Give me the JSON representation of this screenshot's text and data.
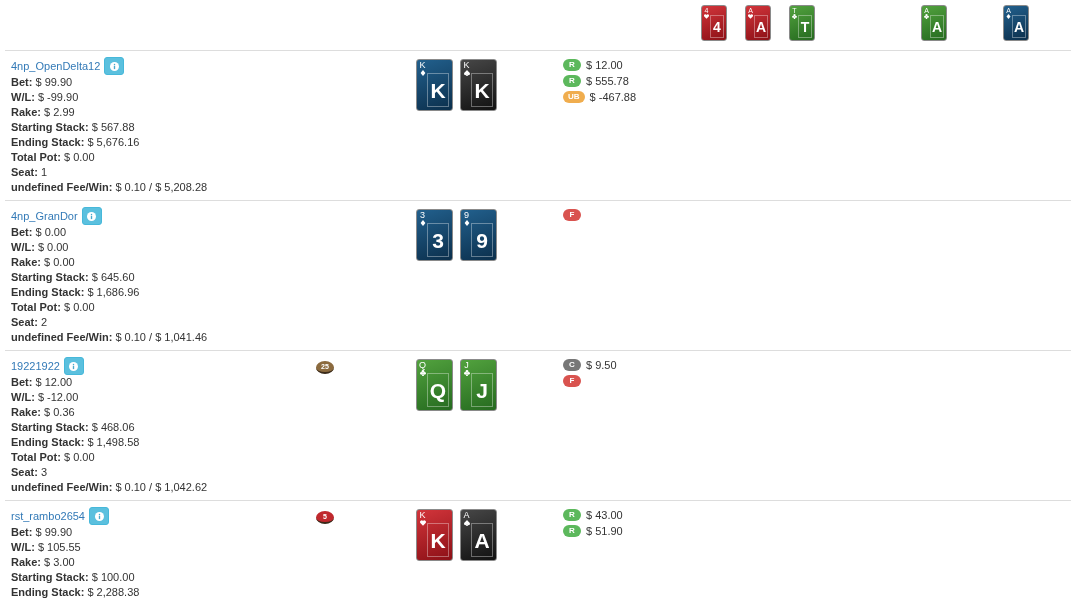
{
  "board": {
    "flop": [
      {
        "corner": "4",
        "rank": "4",
        "kind": "hearts"
      },
      {
        "corner": "A",
        "rank": "A",
        "kind": "hearts"
      },
      {
        "corner": "T",
        "rank": "T",
        "kind": "clubs"
      }
    ],
    "turn": [
      {
        "corner": "A",
        "rank": "A",
        "kind": "clubs"
      }
    ],
    "river": [
      {
        "corner": "A",
        "rank": "A",
        "kind": "diamonds"
      }
    ]
  },
  "players": [
    {
      "name": "4np_OpenDelta12",
      "stats": [
        {
          "label": "Bet:",
          "value": "$ 99.90"
        },
        {
          "label": "W/L:",
          "value": "$ -99.90"
        },
        {
          "label": "Rake:",
          "value": "$ 2.99"
        },
        {
          "label": "Starting Stack:",
          "value": "$ 567.88"
        },
        {
          "label": "Ending Stack:",
          "value": "$ 5,676.16"
        },
        {
          "label": "Total Pot:",
          "value": "$ 0.00"
        },
        {
          "label": "Seat:",
          "value": "1"
        },
        {
          "label": "undefined Fee/Win:",
          "value": "$ 0.10 / $ 5,208.28"
        }
      ],
      "hole_cards": [
        {
          "corner": "K",
          "rank": "K",
          "kind": "diamonds"
        },
        {
          "corner": "K",
          "rank": "K",
          "kind": "spades"
        }
      ],
      "preflop_actions": [
        {
          "kind": "raise",
          "label": "R",
          "amount": "$ 12.00"
        },
        {
          "kind": "raise",
          "label": "R",
          "amount": "$ 555.78"
        },
        {
          "kind": "uncalled",
          "label": "UB",
          "amount": "$ -467.88"
        }
      ]
    },
    {
      "name": "4np_GranDor",
      "stats": [
        {
          "label": "Bet:",
          "value": "$ 0.00"
        },
        {
          "label": "W/L:",
          "value": "$ 0.00"
        },
        {
          "label": "Rake:",
          "value": "$ 0.00"
        },
        {
          "label": "Starting Stack:",
          "value": "$ 645.60"
        },
        {
          "label": "Ending Stack:",
          "value": "$ 1,686.96"
        },
        {
          "label": "Total Pot:",
          "value": "$ 0.00"
        },
        {
          "label": "Seat:",
          "value": "2"
        },
        {
          "label": "undefined Fee/Win:",
          "value": "$ 0.10 / $ 1,041.46"
        }
      ],
      "hole_cards": [
        {
          "corner": "3",
          "rank": "3",
          "kind": "diamonds"
        },
        {
          "corner": "9",
          "rank": "9",
          "kind": "diamonds"
        }
      ],
      "preflop_actions": [
        {
          "kind": "fold",
          "label": "F"
        }
      ]
    },
    {
      "name": "19221922",
      "chip": {
        "value": "25",
        "color": "#8b6a3e"
      },
      "stats": [
        {
          "label": "Bet:",
          "value": "$ 12.00"
        },
        {
          "label": "W/L:",
          "value": "$ -12.00"
        },
        {
          "label": "Rake:",
          "value": "$ 0.36"
        },
        {
          "label": "Starting Stack:",
          "value": "$ 468.06"
        },
        {
          "label": "Ending Stack:",
          "value": "$ 1,498.58"
        },
        {
          "label": "Total Pot:",
          "value": "$ 0.00"
        },
        {
          "label": "Seat:",
          "value": "3"
        },
        {
          "label": "undefined Fee/Win:",
          "value": "$ 0.10 / $ 1,042.62"
        }
      ],
      "hole_cards": [
        {
          "corner": "Q",
          "rank": "Q",
          "kind": "clubs"
        },
        {
          "corner": "J",
          "rank": "J",
          "kind": "clubs"
        }
      ],
      "preflop_actions": [
        {
          "kind": "call",
          "label": "C",
          "amount": "$ 9.50"
        },
        {
          "kind": "fold",
          "label": "F"
        }
      ]
    },
    {
      "name": "rst_rambo2654",
      "chip": {
        "value": "5",
        "color": "#c0282d"
      },
      "stats": [
        {
          "label": "Bet:",
          "value": "$ 99.90"
        },
        {
          "label": "W/L:",
          "value": "$ 105.55"
        },
        {
          "label": "Rake:",
          "value": "$ 3.00"
        },
        {
          "label": "Starting Stack:",
          "value": "$ 100.00"
        },
        {
          "label": "Ending Stack:",
          "value": "$ 2,288.38"
        }
      ],
      "hole_cards": [
        {
          "corner": "K",
          "rank": "K",
          "kind": "hearts"
        },
        {
          "corner": "A",
          "rank": "A",
          "kind": "spades"
        }
      ],
      "preflop_actions": [
        {
          "kind": "raise",
          "label": "R",
          "amount": "$ 43.00"
        },
        {
          "kind": "raise",
          "label": "R",
          "amount": "$ 51.90"
        }
      ]
    }
  ]
}
